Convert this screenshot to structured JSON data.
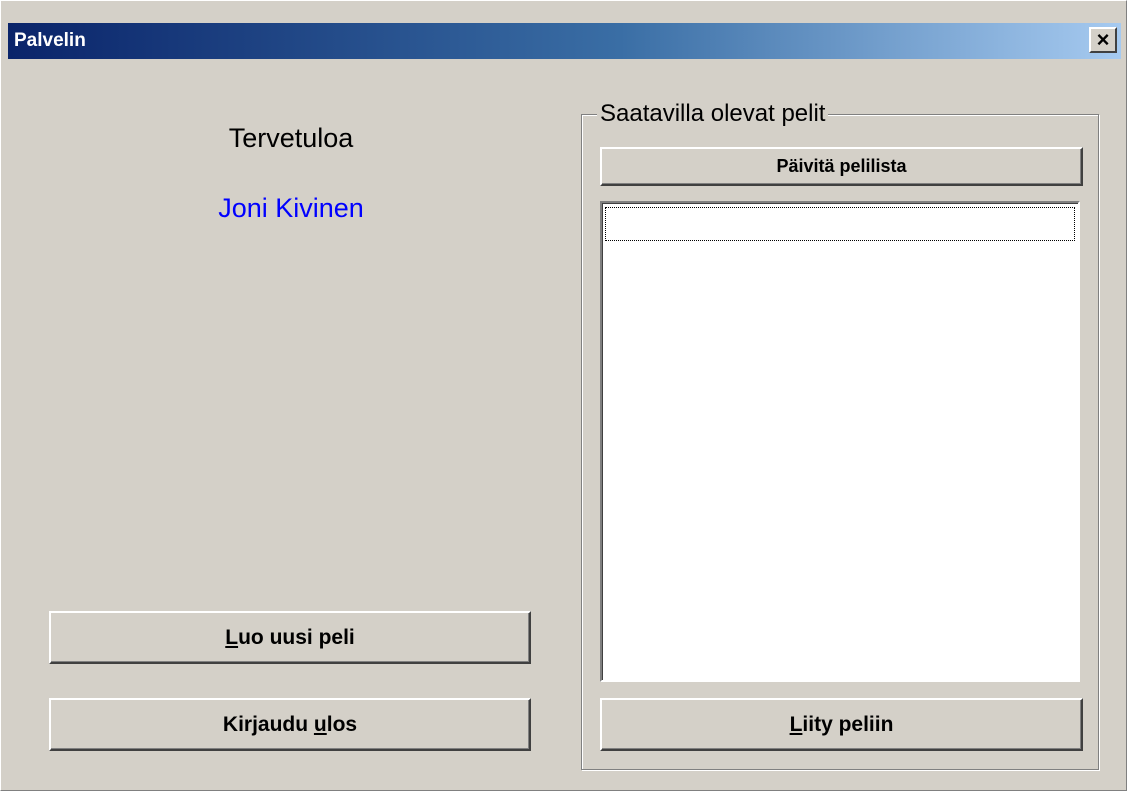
{
  "window": {
    "title": "Palvelin",
    "close_glyph": "×",
    "close_icon": "close-icon"
  },
  "welcome": {
    "greeting": "Tervetuloa",
    "user_name": "Joni Kivinen",
    "user_name_color": "#0000ff"
  },
  "actions": {
    "create_game": {
      "pre": "",
      "accel": "L",
      "post": "uo uusi peli"
    },
    "logout": {
      "pre": "Kirjaudu ",
      "accel": "u",
      "post": "los"
    }
  },
  "games_panel": {
    "label": "Saatavilla olevat pelit",
    "refresh_label": "Päivitä pelilista",
    "games": [],
    "join": {
      "pre": "",
      "accel": "L",
      "post": "iity peliin"
    }
  },
  "colors": {
    "title_gradient_start": "#0a246a",
    "title_gradient_end": "#a6caf0",
    "face": "#d4d0c8"
  }
}
